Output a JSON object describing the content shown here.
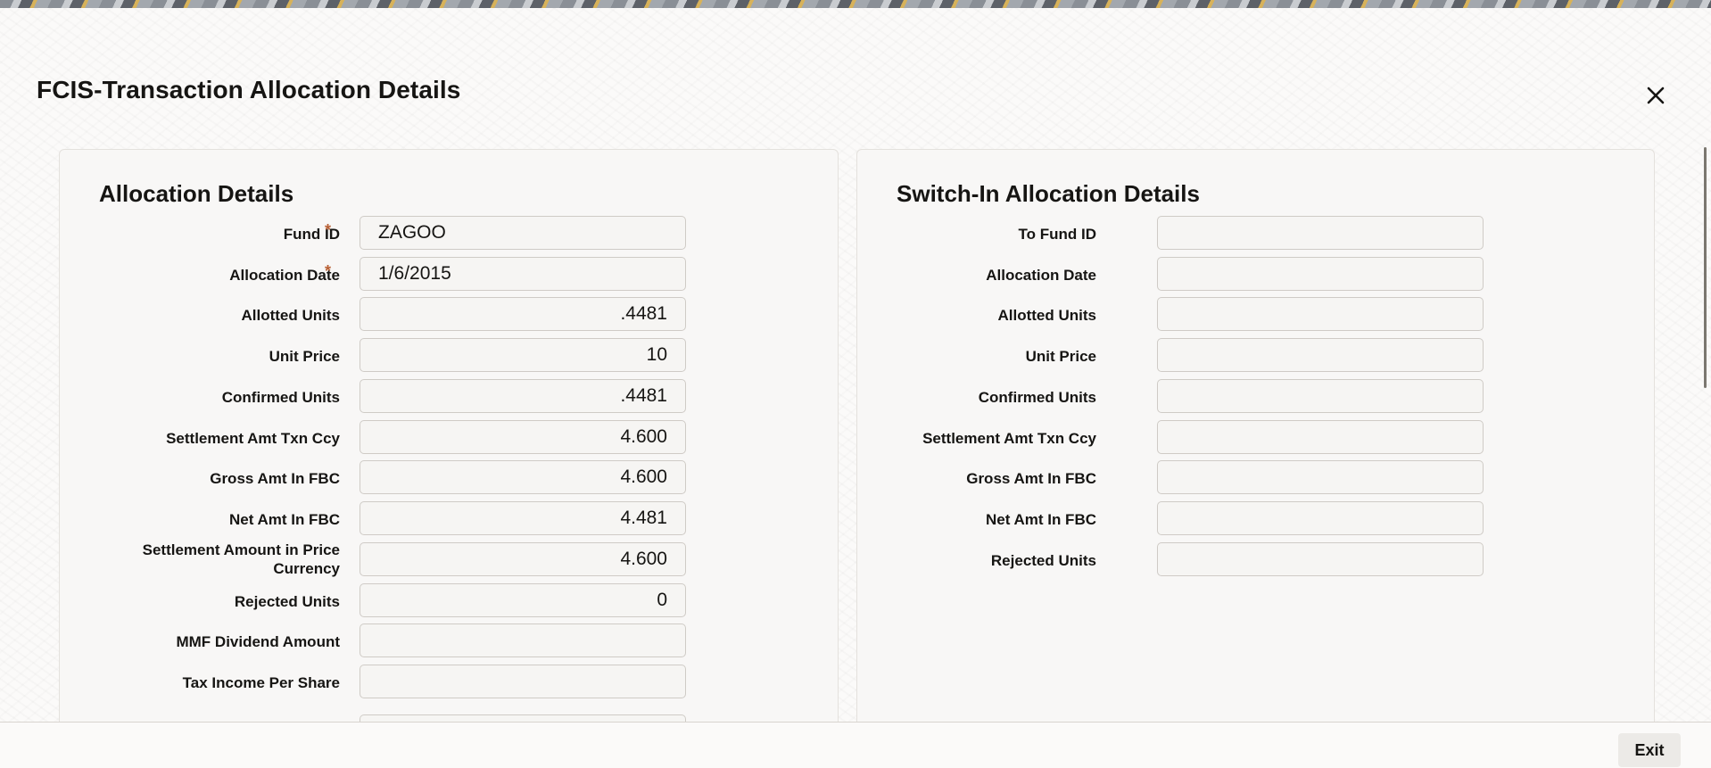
{
  "dialog": {
    "title": "FCIS-Transaction Allocation Details"
  },
  "icons": {
    "close": "close-icon"
  },
  "colors": {
    "required_marker": "#b85f33",
    "panel_background": "#f8f7f6",
    "field_border": "#cfcbc6"
  },
  "allocation": {
    "title": "Allocation Details",
    "fields": [
      {
        "label": "Fund ID",
        "value": "ZAGOO",
        "required": "*"
      },
      {
        "label": "Allocation Date",
        "value": "1/6/2015",
        "required": "*"
      },
      {
        "label": "Allotted Units",
        "value": ".4481"
      },
      {
        "label": "Unit Price",
        "value": "10"
      },
      {
        "label": "Confirmed Units",
        "value": ".4481"
      },
      {
        "label": "Settlement Amt Txn Ccy",
        "value": "4.600"
      },
      {
        "label": "Gross Amt In FBC",
        "value": "4.600"
      },
      {
        "label": "Net Amt In FBC",
        "value": "4.481"
      },
      {
        "label": "Settlement Amount in Price Currency",
        "value": "4.600"
      },
      {
        "label": "Rejected Units",
        "value": "0"
      },
      {
        "label": "MMF Dividend Amount",
        "value": ""
      },
      {
        "label": "Tax Income Per Share",
        "value": ""
      }
    ]
  },
  "switch_in": {
    "title": "Switch-In Allocation Details",
    "fields": [
      {
        "label": "To Fund ID",
        "value": ""
      },
      {
        "label": "Allocation Date",
        "value": ""
      },
      {
        "label": "Allotted Units",
        "value": ""
      },
      {
        "label": "Unit Price",
        "value": ""
      },
      {
        "label": "Confirmed Units",
        "value": ""
      },
      {
        "label": "Settlement Amt Txn Ccy",
        "value": ""
      },
      {
        "label": "Gross Amt In FBC",
        "value": ""
      },
      {
        "label": "Net Amt In FBC",
        "value": ""
      },
      {
        "label": "Rejected Units",
        "value": ""
      }
    ]
  },
  "footer": {
    "exit_label": "Exit"
  }
}
